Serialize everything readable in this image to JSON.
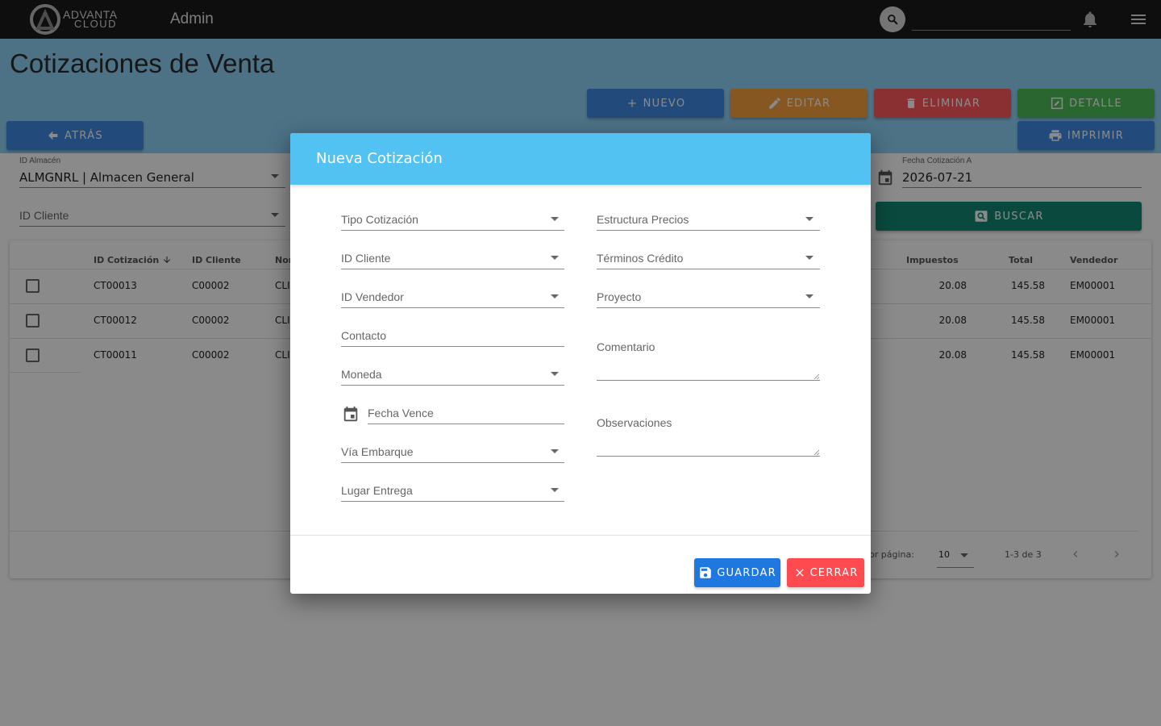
{
  "app": {
    "logo_line1": "ADVANTA",
    "logo_line2": "CLOUD",
    "title": "Admin"
  },
  "page": {
    "title": "Cotizaciones de Venta"
  },
  "toolbar": {
    "nuevo": "NUEVO",
    "editar": "EDITAR",
    "eliminar": "ELIMINAR",
    "detalle": "DETALLE",
    "atras": "ATRÁS",
    "imprimir": "IMPRIMIR",
    "buscar": "BUSCAR"
  },
  "filters": {
    "almacen_label": "ID Almacén",
    "almacen_value": "ALMGNRL | Almacen General",
    "cliente_placeholder": "ID Cliente",
    "fecha_a_label": "Fecha Cotización A",
    "fecha_a_value": "2026-07-21"
  },
  "table": {
    "columns": [
      "ID Cotización",
      "ID Cliente",
      "Nor",
      "Impuestos",
      "Total",
      "Vendedor"
    ],
    "rows": [
      {
        "id": "CT00013",
        "cliente": "C00002",
        "nombre": "CLI",
        "impuestos": "20.08",
        "total": "145.58",
        "vendedor": "EM00001"
      },
      {
        "id": "CT00012",
        "cliente": "C00002",
        "nombre": "CLI",
        "impuestos": "20.08",
        "total": "145.58",
        "vendedor": "EM00001"
      },
      {
        "id": "CT00011",
        "cliente": "C00002",
        "nombre": "CLI",
        "impuestos": "20.08",
        "total": "145.58",
        "vendedor": "EM00001"
      }
    ],
    "footer": {
      "per_page_label": "or página:",
      "per_page_value": "10",
      "range": "1-3 de 3"
    }
  },
  "dialog": {
    "title": "Nueva Cotización",
    "left_fields": [
      "Tipo Cotización",
      "ID Cliente",
      "ID Vendedor",
      "Contacto",
      "Moneda",
      "Fecha Vence",
      "Vía Embarque",
      "Lugar Entrega"
    ],
    "right_fields": [
      "Estructura Precios",
      "Términos Crédito",
      "Proyecto",
      "Comentario",
      "Observaciones"
    ],
    "guardar": "GUARDAR",
    "cerrar": "CERRAR"
  },
  "colors": {
    "topbar": "#1b1b1b",
    "band": "#8ed3f7",
    "dialog_header": "#52c2f2",
    "primary": "#3f8be3",
    "warning": "#f9a13e",
    "danger": "#ff5a5f",
    "success": "#4fbd5a",
    "search": "#138a73"
  }
}
